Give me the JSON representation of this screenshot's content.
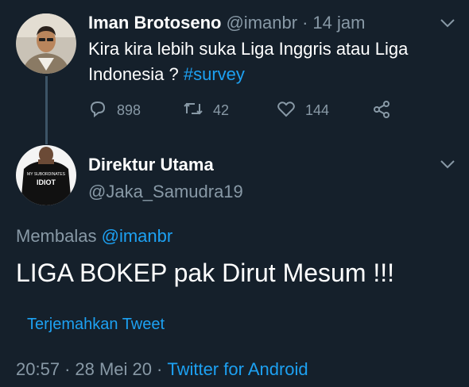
{
  "original_tweet": {
    "display_name": "Iman Brotoseno",
    "handle": "@imanbr",
    "separator": "·",
    "time": "14 jam",
    "text_line1": "Kira kira lebih suka Liga Inggris atau Liga",
    "text_line2_prefix": "Indonesia ? ",
    "hashtag": "#survey",
    "actions": {
      "replies": "898",
      "retweets": "42",
      "likes": "144"
    }
  },
  "reply_tweet": {
    "display_name": "Direktur Utama",
    "handle": "@Jaka_Samudra19",
    "replying_label": "Membalas",
    "replying_to": "@imanbr",
    "text": "LIGA BOKEP pak Dirut Mesum !!!",
    "translate_label": "Terjemahkan Tweet",
    "time": "20:57",
    "date": "28 Mei 20",
    "separator": "·",
    "client": "Twitter for Android",
    "shirt_text_top": "MY SUBORDINATES",
    "shirt_text_bottom": "IDIOT"
  },
  "colors": {
    "background": "#15202b",
    "text": "#ffffff",
    "muted": "#8899a6",
    "accent": "#1da1f2",
    "thread_line": "#3d5466"
  },
  "icons": [
    "reply-icon",
    "retweet-icon",
    "like-icon",
    "share-icon",
    "chevron-down-icon"
  ]
}
